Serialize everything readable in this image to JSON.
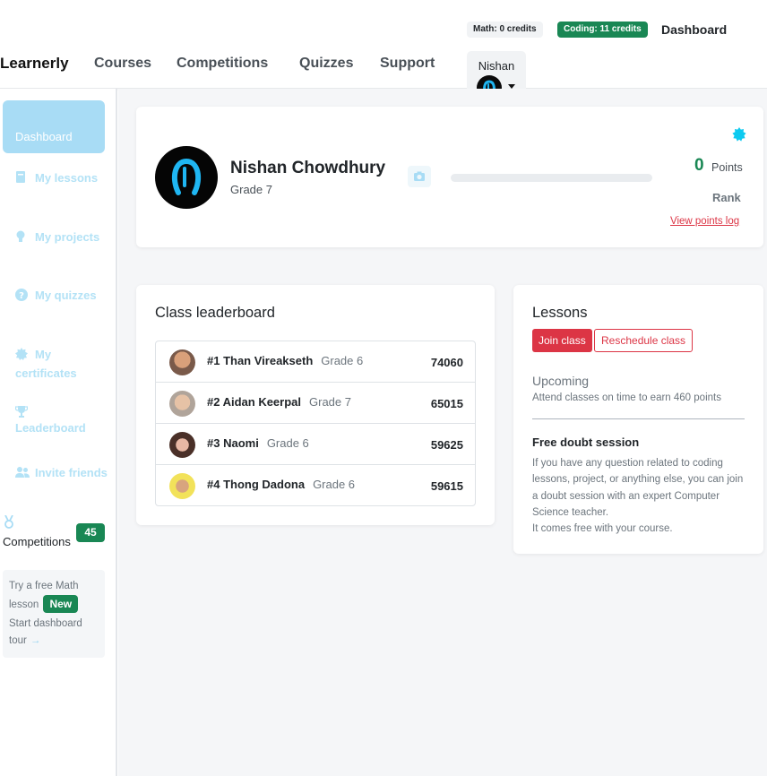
{
  "header": {
    "credits": {
      "math": "Math: 0 credits",
      "coding": "Coding: 11 credits"
    },
    "dashboard_link": "Dashboard",
    "brand": "Learnerly",
    "nav": [
      "Courses",
      "Competitions",
      "Quizzes",
      "Support"
    ],
    "user_name": "Nishan"
  },
  "sidebar": {
    "dashboard": "Dashboard",
    "items": [
      {
        "label": "My lessons",
        "icon": "book-icon"
      },
      {
        "label": "My projects",
        "icon": "lightbulb-icon"
      },
      {
        "label": "My quizzes",
        "icon": "question-icon"
      },
      {
        "label": "My certificates",
        "icon": "certificate-icon"
      },
      {
        "label": "Leaderboard",
        "icon": "trophy-icon"
      },
      {
        "label": "Invite friends",
        "icon": "people-icon"
      }
    ],
    "competitions_label": "Competitions",
    "competitions_count": "45",
    "try_text": "Try a free Math lesson",
    "new_badge": "New",
    "tour_text": "Start dashboard tour"
  },
  "profile": {
    "name": "Nishan Chowdhury",
    "grade": "Grade 7",
    "points": "0",
    "points_label": "Points",
    "rank_label": "Rank",
    "points_log_link": "View points log",
    "progress": 0
  },
  "leaderboard": {
    "title": "Class leaderboard",
    "rows": [
      {
        "rank_name": "#1 Than Vireakseth",
        "grade": "Grade 6",
        "score": "74060"
      },
      {
        "rank_name": "#2 Aidan Keerpal",
        "grade": "Grade 7",
        "score": "65015"
      },
      {
        "rank_name": "#3 Naomi",
        "grade": "Grade 6",
        "score": "59625"
      },
      {
        "rank_name": "#4 Thong Dadona",
        "grade": "Grade 6",
        "score": "59615"
      }
    ]
  },
  "lessons": {
    "title": "Lessons",
    "join_button": "Join class",
    "reschedule_button": "Reschedule class",
    "upcoming": "Upcoming",
    "attend_text": "Attend classes on time to earn 460 points",
    "doubt_title": "Free doubt session",
    "doubt_body": "If you have any question related to coding lessons, project, or anything else, you can join a doubt session with an expert Computer Science teacher.",
    "doubt_footer": "It comes free with your course."
  },
  "colors": {
    "accent_green": "#198754",
    "accent_red": "#dc3545",
    "sidebar_blue": "#a8dcf5"
  }
}
